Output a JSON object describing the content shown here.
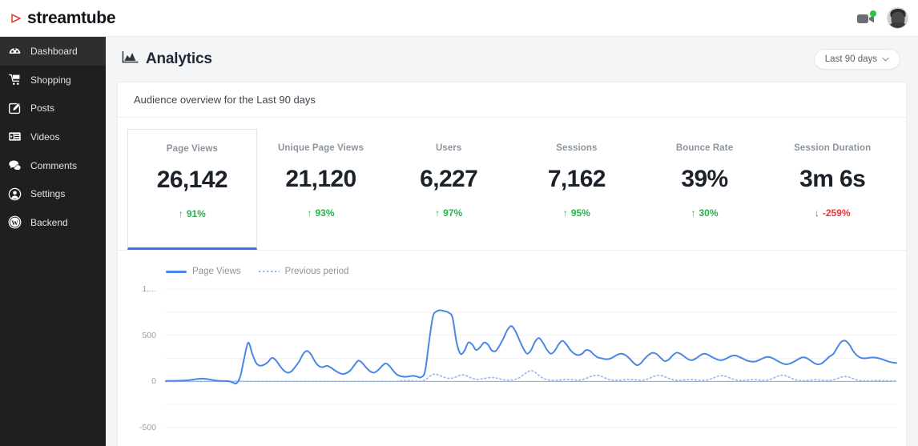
{
  "brand": {
    "name": "streamtube",
    "logo_icon": "play-triangle-icon",
    "accent": "#e8402a"
  },
  "topbar": {
    "video_icon": "video-camera-icon",
    "video_status_color": "#25c940",
    "avatar_icon": "user-avatar"
  },
  "sidebar": {
    "items": [
      {
        "label": "Dashboard",
        "icon": "speedometer-icon",
        "active": true
      },
      {
        "label": "Shopping",
        "icon": "shopping-cart-icon",
        "active": false
      },
      {
        "label": "Posts",
        "icon": "edit-square-icon",
        "active": false
      },
      {
        "label": "Videos",
        "icon": "video-list-icon",
        "active": false
      },
      {
        "label": "Comments",
        "icon": "comments-icon",
        "active": false
      },
      {
        "label": "Settings",
        "icon": "user-circle-icon",
        "active": false
      },
      {
        "label": "Backend",
        "icon": "wordpress-icon",
        "active": false
      }
    ]
  },
  "header": {
    "title": "Analytics",
    "title_icon": "area-chart-icon",
    "range_label": "Last 90 days",
    "range_caret_icon": "chevron-down-icon"
  },
  "card": {
    "subtitle": "Audience overview for the Last 90 days"
  },
  "stats": [
    {
      "label": "Page Views",
      "value": "26,142",
      "delta": "91%",
      "dir": "up",
      "active": true
    },
    {
      "label": "Unique Page Views",
      "value": "21,120",
      "delta": "93%",
      "dir": "up",
      "active": false
    },
    {
      "label": "Users",
      "value": "6,227",
      "delta": "97%",
      "dir": "up",
      "active": false
    },
    {
      "label": "Sessions",
      "value": "7,162",
      "delta": "95%",
      "dir": "up",
      "active": false
    },
    {
      "label": "Bounce Rate",
      "value": "39%",
      "delta": "30%",
      "dir": "up",
      "active": false
    },
    {
      "label": "Session Duration",
      "value": "3m 6s",
      "delta": "-259%",
      "dir": "down",
      "active": false
    }
  ],
  "colors": {
    "series_primary": "#4a86e8",
    "series_previous": "#9dbdf2",
    "up": "#25b34b",
    "down": "#e53535",
    "active_underline": "#3b76e8",
    "sidebar_bg": "#1f1f1f",
    "page_bg": "#f4f5f7"
  },
  "chart_data": {
    "type": "line",
    "title": "",
    "xlabel": "",
    "ylabel": "",
    "ylim": [
      -500,
      1000
    ],
    "yticks": [
      1000,
      500,
      0,
      -500
    ],
    "ytick_labels": [
      "1,...",
      "500",
      "0",
      "-500"
    ],
    "grid": true,
    "legend_position": "top-left",
    "series": [
      {
        "name": "Page Views",
        "style": "solid",
        "color": "#4a86e8",
        "values": [
          5,
          6,
          6,
          7,
          8,
          10,
          14,
          20,
          26,
          30,
          28,
          22,
          14,
          8,
          5,
          4,
          3,
          -12,
          -20,
          60,
          260,
          420,
          300,
          200,
          170,
          180,
          210,
          255,
          230,
          170,
          120,
          95,
          110,
          160,
          220,
          300,
          330,
          290,
          215,
          165,
          155,
          170,
          150,
          120,
          95,
          80,
          90,
          120,
          175,
          225,
          200,
          150,
          110,
          95,
          120,
          165,
          195,
          165,
          110,
          70,
          55,
          50,
          55,
          60,
          52,
          45,
          110,
          420,
          700,
          760,
          770,
          760,
          745,
          690,
          430,
          300,
          330,
          420,
          400,
          340,
          370,
          420,
          400,
          335,
          330,
          390,
          470,
          560,
          600,
          545,
          450,
          360,
          300,
          340,
          430,
          470,
          420,
          345,
          300,
          330,
          400,
          440,
          400,
          340,
          300,
          285,
          300,
          340,
          330,
          290,
          260,
          250,
          240,
          245,
          265,
          290,
          300,
          285,
          250,
          205,
          175,
          200,
          250,
          290,
          310,
          295,
          255,
          220,
          235,
          280,
          310,
          300,
          270,
          240,
          230,
          250,
          280,
          300,
          290,
          265,
          245,
          230,
          235,
          255,
          275,
          280,
          265,
          245,
          225,
          215,
          215,
          230,
          250,
          265,
          260,
          240,
          215,
          195,
          185,
          195,
          215,
          240,
          260,
          255,
          230,
          200,
          185,
          195,
          230,
          270,
          300,
          370,
          430,
          440,
          400,
          330,
          280,
          255,
          250,
          255,
          260,
          255,
          245,
          230,
          215,
          205,
          200
        ]
      },
      {
        "name": "Previous period",
        "style": "dotted",
        "color": "#9dbdf2",
        "values": [
          0,
          0,
          0,
          0,
          0,
          0,
          0,
          0,
          0,
          0,
          0,
          0,
          0,
          0,
          0,
          0,
          0,
          0,
          0,
          0,
          0,
          0,
          0,
          0,
          0,
          0,
          0,
          0,
          0,
          0,
          0,
          0,
          0,
          0,
          0,
          0,
          0,
          0,
          0,
          0,
          0,
          0,
          0,
          0,
          0,
          0,
          0,
          0,
          0,
          0,
          0,
          0,
          0,
          0,
          0,
          0,
          0,
          0,
          0,
          0,
          4,
          8,
          10,
          8,
          5,
          3,
          5,
          25,
          58,
          78,
          72,
          55,
          40,
          32,
          38,
          55,
          70,
          66,
          48,
          30,
          22,
          25,
          32,
          40,
          42,
          36,
          26,
          18,
          14,
          16,
          24,
          40,
          70,
          100,
          118,
          100,
          66,
          36,
          20,
          14,
          12,
          14,
          18,
          22,
          20,
          16,
          14,
          18,
          30,
          48,
          62,
          66,
          56,
          38,
          22,
          14,
          12,
          14,
          18,
          22,
          20,
          16,
          14,
          16,
          26,
          44,
          60,
          66,
          58,
          40,
          24,
          14,
          12,
          14,
          18,
          20,
          18,
          14,
          12,
          14,
          22,
          38,
          55,
          62,
          56,
          40,
          24,
          14,
          10,
          12,
          16,
          20,
          18,
          14,
          12,
          16,
          28,
          48,
          64,
          66,
          54,
          34,
          18,
          10,
          8,
          10,
          14,
          18,
          16,
          12,
          10,
          12,
          20,
          34,
          48,
          52,
          44,
          28,
          14,
          8,
          6,
          6,
          8,
          10,
          10,
          8,
          6,
          5,
          4
        ]
      }
    ]
  }
}
